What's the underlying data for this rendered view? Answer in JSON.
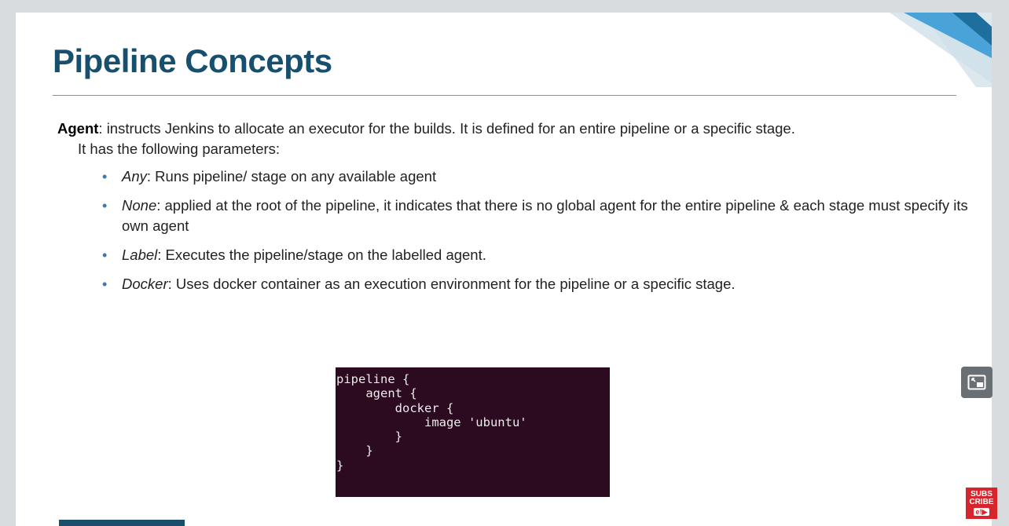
{
  "slide": {
    "title": "Pipeline Concepts",
    "intro": {
      "term": "Agent",
      "text": ": instructs Jenkins to allocate an executor for the builds. It is defined for an entire pipeline or a specific stage.",
      "subtext": "It has the following parameters:"
    },
    "bullets": [
      {
        "keyword": "Any",
        "text": ": Runs pipeline/ stage on any available agent"
      },
      {
        "keyword": "None",
        "text": ": applied at the root of the pipeline, it indicates that there is no global agent for the entire pipeline & each stage must specify its own agent"
      },
      {
        "keyword": "Label",
        "text": ": Executes the pipeline/stage on the labelled agent."
      },
      {
        "keyword": "Docker",
        "text": ": Uses docker container as an execution environment for the pipeline or a specific stage."
      }
    ],
    "code": "pipeline {\n    agent {\n        docker {\n            image 'ubuntu'\n        }\n    }\n}"
  },
  "overlay": {
    "pip_icon": "picture-in-picture-icon",
    "subscribe_lines": [
      "SUBS",
      "CRIBE",
      "e!▶"
    ]
  },
  "colors": {
    "title": "#17506e",
    "bullet": "#3a7ab0",
    "code_bg": "#2c0a1f",
    "accent_light": "#4aa3d8",
    "accent_dark": "#1a4e6a",
    "subscribe": "#d7262b"
  }
}
